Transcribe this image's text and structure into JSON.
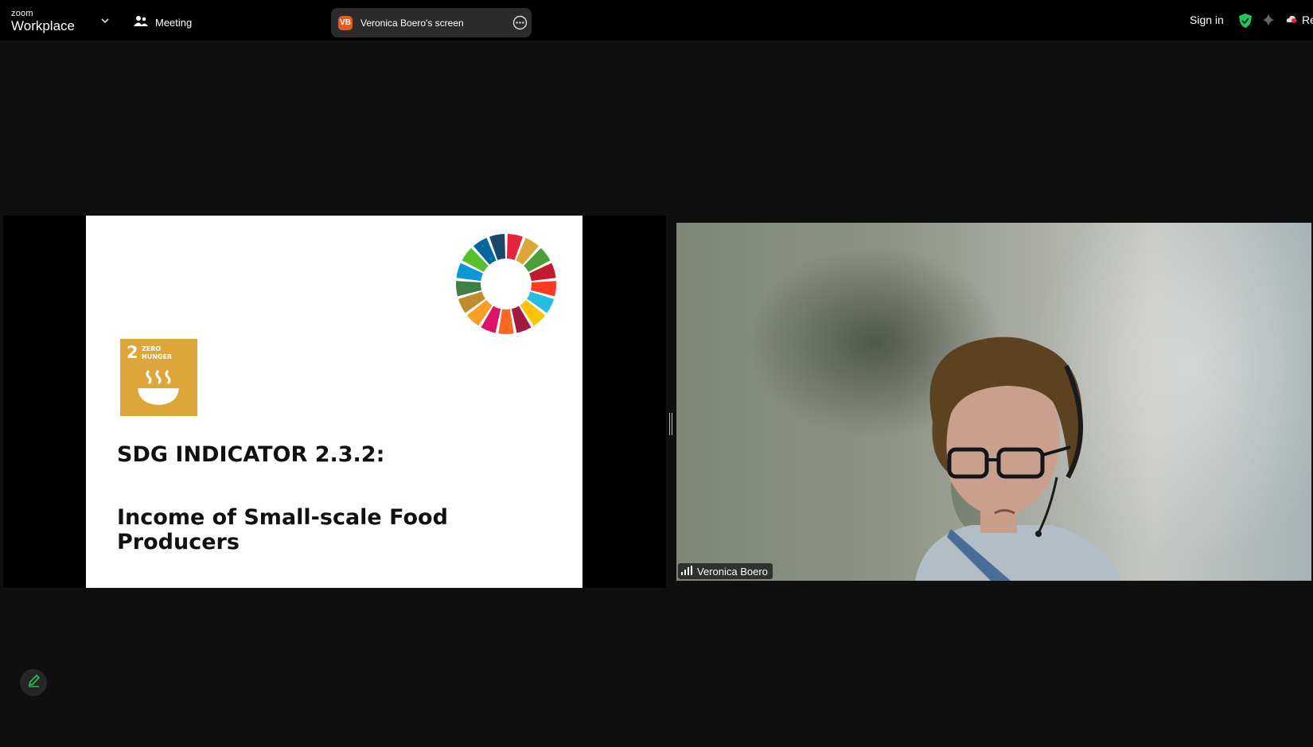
{
  "app": {
    "logo_small": "zoom",
    "logo_big": "Workplace",
    "meeting_label": "Meeting"
  },
  "share_pill": {
    "initials": "VB",
    "label": "Veronica Boero's screen",
    "badge_color": "#e8591b"
  },
  "topbar_right": {
    "sign_in": "Sign in",
    "record_partial": "Re",
    "shield_color": "#22c55e"
  },
  "slide": {
    "heading": "SDG INDICATOR 2.3.2:",
    "subheading": "Income of Small-scale Food Producers",
    "goal": {
      "number": "2",
      "line1": "ZERO",
      "line2": "HUNGER",
      "color": "#dda63a"
    },
    "wheel_colors": [
      "#e5243b",
      "#dda63a",
      "#4c9f38",
      "#c5192d",
      "#ff3a21",
      "#26bde2",
      "#fcc30b",
      "#a21942",
      "#fd6925",
      "#dd1367",
      "#fd9d24",
      "#bf8b2e",
      "#3f7e44",
      "#0a97d9",
      "#56c02b",
      "#00689d",
      "#19486a"
    ]
  },
  "participant": {
    "name": "Veronica Boero"
  },
  "icons": [
    "chevron-down-icon",
    "meeting-people-icon",
    "more-options-icon",
    "shield-check-icon",
    "sparkle-icon",
    "cloud-record-icon",
    "signal-bars-icon",
    "pencil-icon"
  ]
}
